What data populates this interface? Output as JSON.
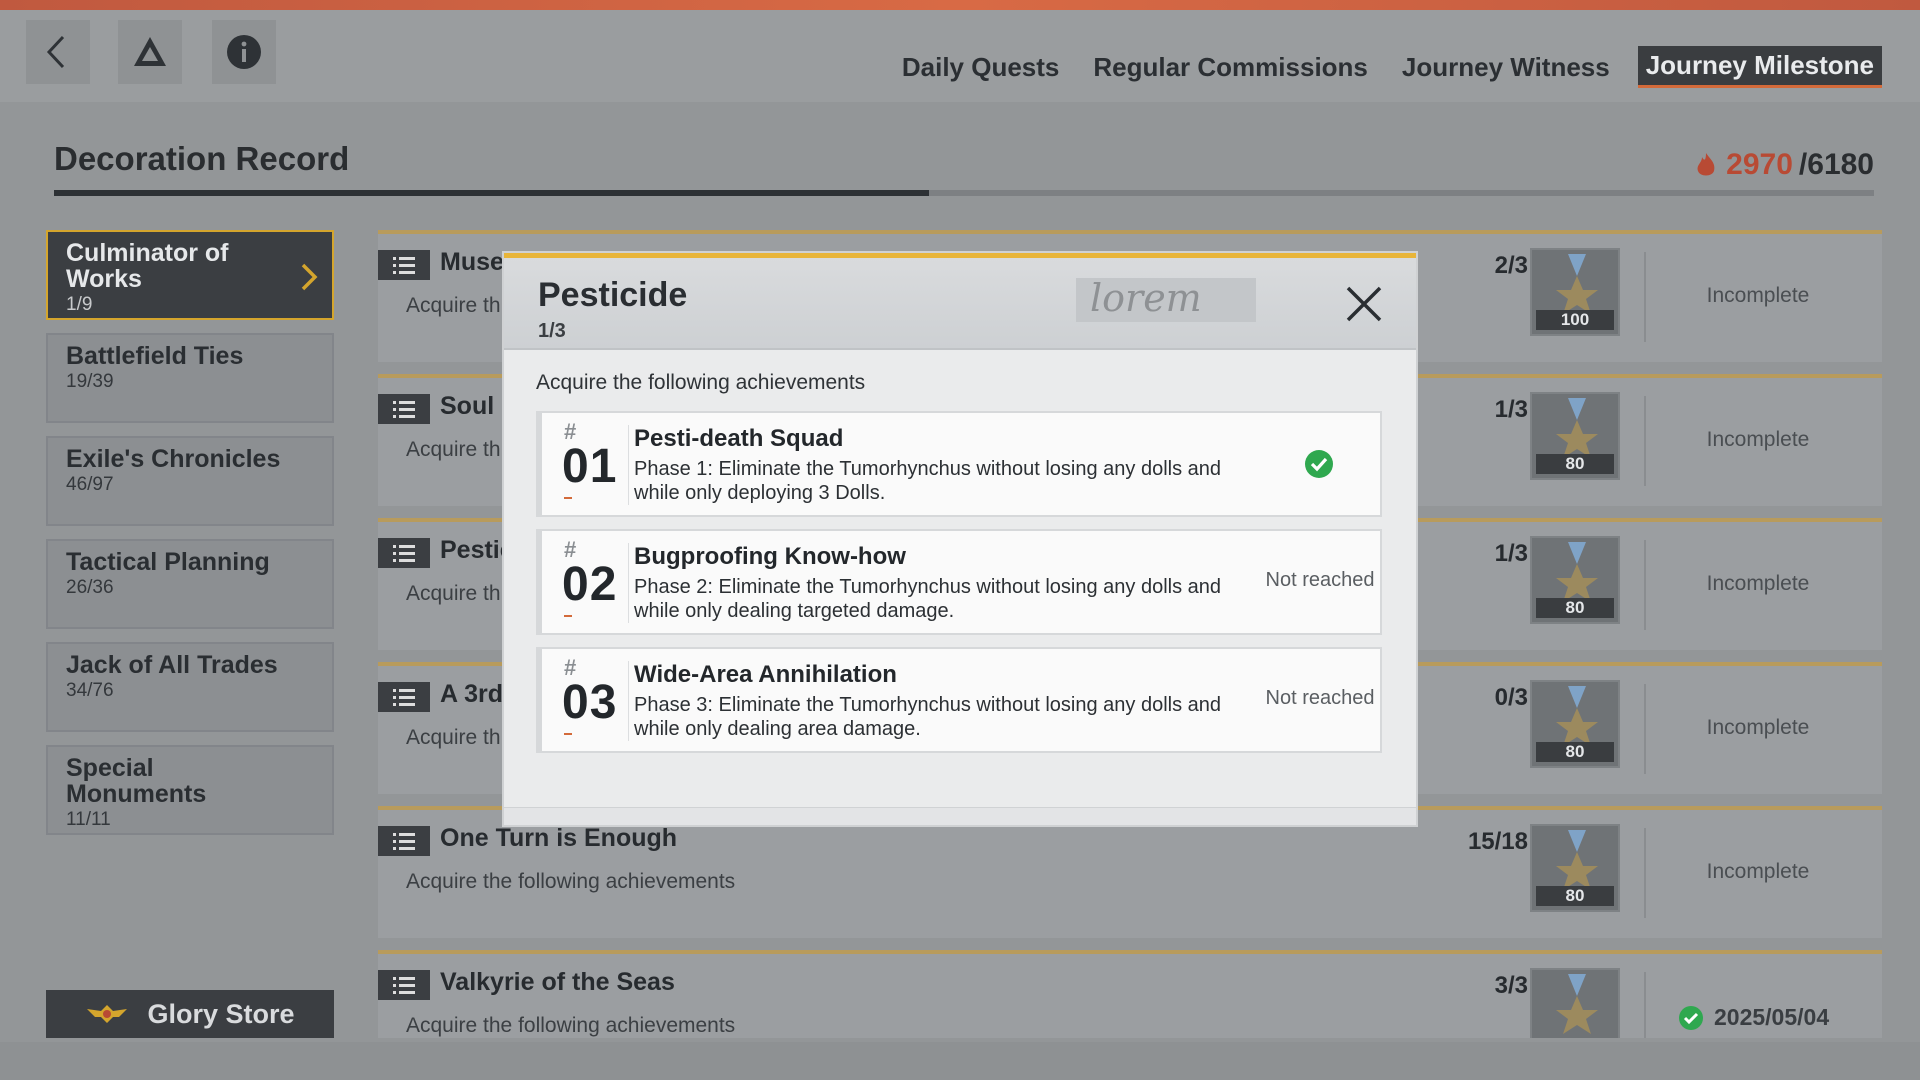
{
  "nav": {
    "tabs": [
      {
        "label": "Daily Quests",
        "active": false
      },
      {
        "label": "Regular Commissions",
        "active": false
      },
      {
        "label": "Journey Witness",
        "active": false
      },
      {
        "label": "Journey Milestone",
        "active": true
      }
    ]
  },
  "header": {
    "title": "Decoration Record",
    "points_current": "2970",
    "points_total": "/6180",
    "progress_fraction": 0.481
  },
  "sidebar": {
    "items": [
      {
        "label": "Culminator of Works",
        "count": "1/9",
        "active": true
      },
      {
        "label": "Battlefield Ties",
        "count": "19/39",
        "active": false
      },
      {
        "label": "Exile's Chronicles",
        "count": "46/97",
        "active": false
      },
      {
        "label": "Tactical Planning",
        "count": "26/36",
        "active": false
      },
      {
        "label": "Jack of All Trades",
        "count": "34/76",
        "active": false
      },
      {
        "label": "Special Monuments",
        "count": "11/11",
        "active": false
      }
    ],
    "glory_store_label": "Glory Store"
  },
  "rows": [
    {
      "title": "Muse",
      "desc": "Acquire th",
      "count": "2/3",
      "points": "100",
      "status": "Incomplete"
    },
    {
      "title": "Soul c",
      "desc": "Acquire th",
      "count": "1/3",
      "points": "80",
      "status": "Incomplete"
    },
    {
      "title": "Pestic",
      "desc": "Acquire th",
      "count": "1/3",
      "points": "80",
      "status": "Incomplete"
    },
    {
      "title": "A 3rd",
      "desc": "Acquire th",
      "count": "0/3",
      "points": "80",
      "status": "Incomplete"
    },
    {
      "title": "One Turn is Enough",
      "desc": "Acquire the following achievements",
      "count": "15/18",
      "points": "80",
      "status": "Incomplete"
    },
    {
      "title": "Valkyrie of the Seas",
      "desc": "Acquire the following achievements",
      "count": "3/3",
      "points": "",
      "status": "",
      "date": "2025/05/04"
    }
  ],
  "modal": {
    "title": "Pesticide",
    "progress": "1/3",
    "deco_text": "lorem",
    "subtitle": "Acquire the following achievements",
    "achievements": [
      {
        "hash": "#",
        "num": "01",
        "name": "Pesti-death Squad",
        "desc": "Phase 1: Eliminate the Tumorhynchus without losing any dolls and while only deploying 3 Dolls.",
        "state": "",
        "completed": true
      },
      {
        "hash": "#",
        "num": "02",
        "name": "Bugproofing Know-how",
        "desc": "Phase 2: Eliminate the Tumorhynchus without losing any dolls and while only dealing targeted damage.",
        "state": "Not reached",
        "completed": false
      },
      {
        "hash": "#",
        "num": "03",
        "name": "Wide-Area Annihilation",
        "desc": "Phase 3: Eliminate the Tumorhynchus without losing any dolls and while only dealing area damage.",
        "state": "Not reached",
        "completed": false
      }
    ]
  },
  "colors": {
    "accent_orange": "#d36a3a",
    "modal_accent": "#e8b53a",
    "completed_green": "#2fa84f",
    "points_red": "#b84a34"
  },
  "icons": [
    "back-icon",
    "triangle-logo-icon",
    "info-icon",
    "flame-icon",
    "chevron-right-icon",
    "list-icon",
    "medal-icon",
    "close-icon",
    "check-circle-icon",
    "winged-emblem-icon"
  ]
}
